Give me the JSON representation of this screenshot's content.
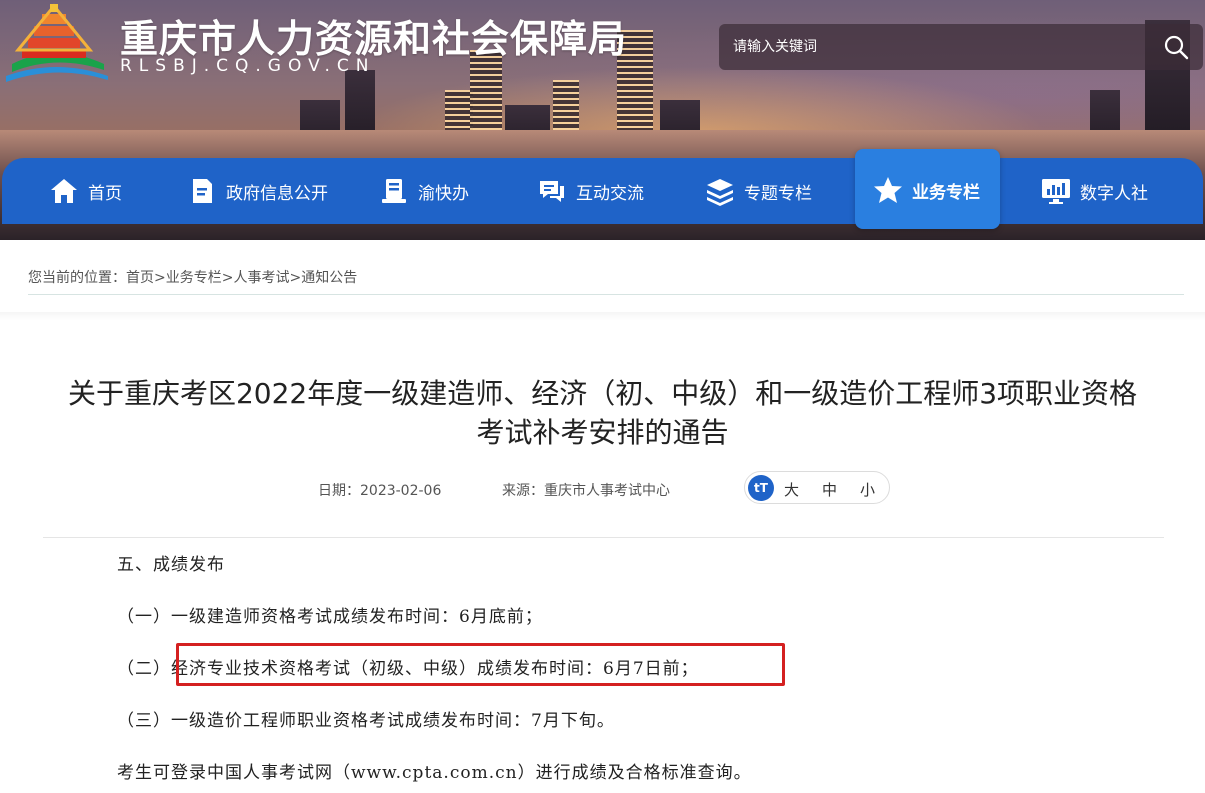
{
  "header": {
    "site_title": "重庆市人力资源和社会保障局",
    "site_domain": "RLSBJ.CQ.GOV.CN",
    "search_placeholder": "请输入关键词"
  },
  "nav": {
    "items": [
      {
        "label": "首页",
        "icon": "home-icon"
      },
      {
        "label": "政府信息公开",
        "icon": "document-icon"
      },
      {
        "label": "渝快办",
        "icon": "service-icon"
      },
      {
        "label": "互动交流",
        "icon": "chat-icon"
      },
      {
        "label": "专题专栏",
        "icon": "layers-icon"
      },
      {
        "label": "业务专栏",
        "icon": "star-icon",
        "active": true
      },
      {
        "label": "数字人社",
        "icon": "monitor-chart-icon"
      }
    ],
    "active_color": "#2a7fe0",
    "bar_color": "#1f63c8"
  },
  "breadcrumb": {
    "prefix": "您当前的位置：",
    "items": [
      "首页",
      "业务专栏",
      "人事考试",
      "通知公告"
    ],
    "separator": ">"
  },
  "article": {
    "title_line1": "关于重庆考区2022年度一级建造师、经济（初、中级）和一级造价工程师3项职业资格",
    "title_line2": "考试补考安排的通告",
    "date": "日期：2023-02-06",
    "source": "来源：重庆市人事考试中心",
    "font_badge": "tT",
    "font_sizes": [
      "大",
      "中",
      "小"
    ],
    "paragraphs": [
      "五、成绩发布",
      "（一）一级建造师资格考试成绩发布时间：6月底前；",
      "（二）经济专业技术资格考试（初级、中级）成绩发布时间：6月7日前；",
      "（三）一级造价工程师职业资格考试成绩发布时间：7月下旬。",
      "考生可登录中国人事考试网（www.cpta.com.cn）进行成绩及合格标准查询。"
    ],
    "highlight_color": "#d42020"
  }
}
